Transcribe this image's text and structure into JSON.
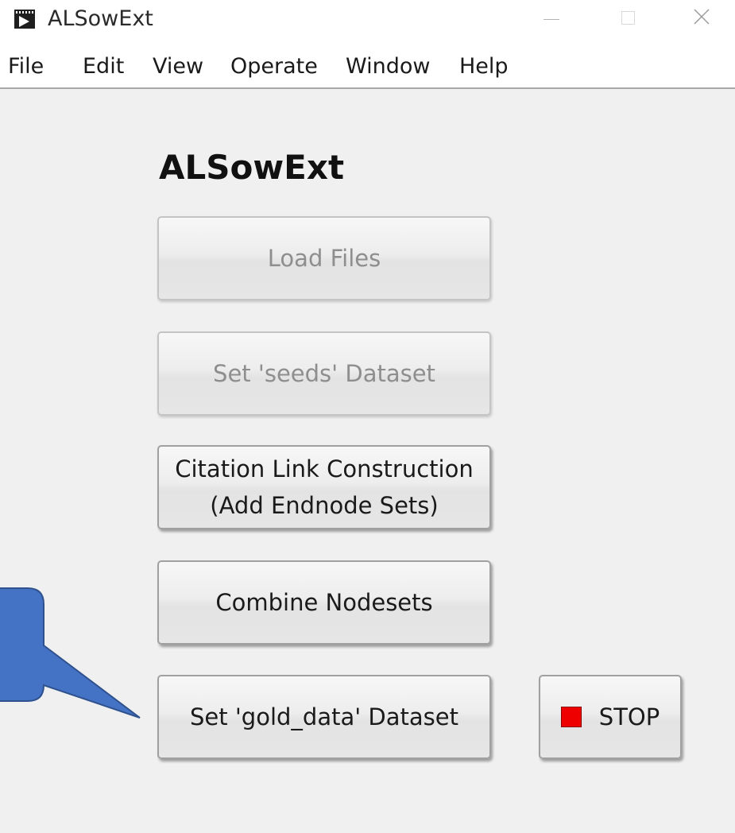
{
  "window": {
    "title": "ALSowExt",
    "icon": "labview-vi-icon"
  },
  "menu": {
    "items": [
      "File",
      "Edit",
      "View",
      "Operate",
      "Window",
      "Help"
    ]
  },
  "panel": {
    "heading": "ALSowExt",
    "buttons": {
      "load_files": "Load Files",
      "set_seeds": "Set 'seeds' Dataset",
      "citation_line1": "Citation Link Construction",
      "citation_line2": "(Add Endnode Sets)",
      "combine_nodesets": "Combine Nodesets",
      "set_gold_data": "Set 'gold_data' Dataset",
      "stop": "STOP"
    },
    "disabled": [
      "load_files",
      "set_seeds"
    ]
  },
  "colors": {
    "callout_fill": "#4472c4",
    "callout_stroke": "#2f528f",
    "stop_indicator": "#ee0000"
  }
}
